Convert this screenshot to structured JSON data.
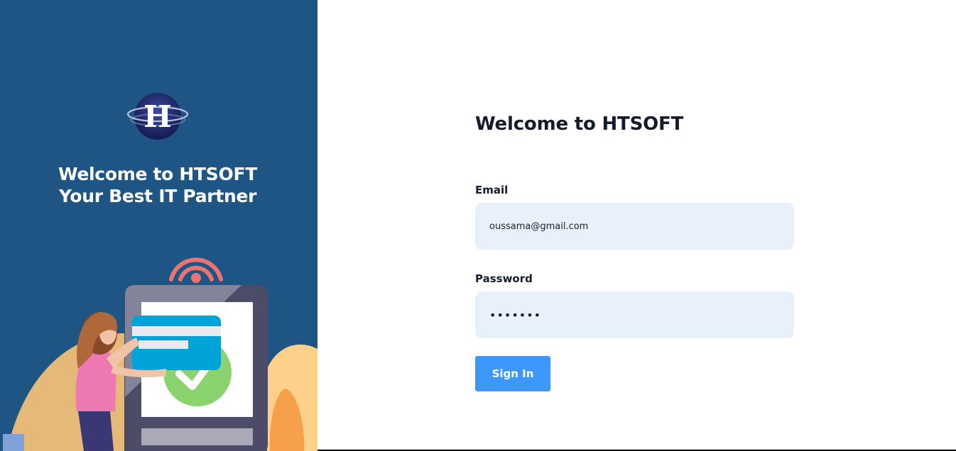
{
  "left_panel": {
    "logo_letter": "H",
    "welcome_line_1": "Welcome to HTSOFT",
    "welcome_line_2": "Your Best IT Partner"
  },
  "form": {
    "title": "Welcome to HTSOFT",
    "email_label": "Email",
    "email_value": "oussama@gmail.com",
    "password_label": "Password",
    "password_value": "•••••••",
    "sign_in_label": "Sign In"
  },
  "colors": {
    "left_panel_bg": "#1f5585",
    "input_bg": "#e8f0fc",
    "button_bg": "#3e97fb",
    "title_text": "#141c2b"
  }
}
